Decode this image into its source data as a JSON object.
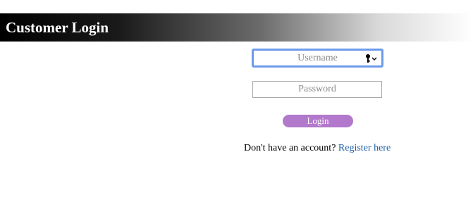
{
  "header": {
    "title": "Customer Login"
  },
  "form": {
    "username_placeholder": "Username",
    "username_value": "",
    "password_placeholder": "Password",
    "password_value": "",
    "login_label": "Login"
  },
  "footer": {
    "prompt": "Don't have an account?",
    "register_link": "Register here"
  },
  "colors": {
    "login_button": "#b278cb",
    "focus_border": "#6d9be9",
    "link": "#1f5fa8"
  },
  "icons": {
    "username_field_icon": "key-icon"
  }
}
